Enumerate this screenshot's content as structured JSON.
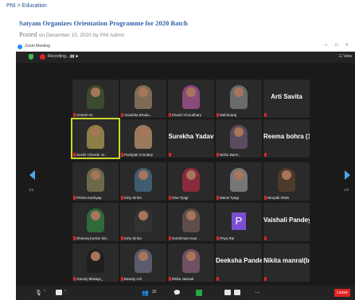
{
  "breadcrumb": "PNI > Education",
  "article": {
    "title": "Satyam Organizes Orientation Programme for 2020 Batch",
    "posted_label": "Posted",
    "posted_on": "on December 15, 2020 by",
    "author": "PNI Admin"
  },
  "zoom": {
    "window_title": "Zoom Meeting",
    "recording_label": "Recording...",
    "recording_controls": "▮▮  ■",
    "view_label": "☷ View",
    "window_controls": [
      "–",
      "□",
      "×"
    ],
    "page_left": "1/2",
    "page_right": "1/2",
    "participant_count": "32",
    "leave_label": "Leave"
  },
  "tiles": [
    {
      "label": "Umesh Nr..",
      "type": "video",
      "color": "#3c4a2e"
    },
    {
      "label": "Anushka Bhadu..",
      "type": "video",
      "color": "#7d6b58"
    },
    {
      "label": "Khushi Choudhary",
      "type": "video",
      "color": "#8a4a7a"
    },
    {
      "label": "Mahimaraj",
      "type": "video",
      "color": "#6a6a6a"
    },
    {
      "label": "",
      "type": "name",
      "name": "Arti Savita"
    },
    {
      "label": "Sushil Chande Jo..",
      "type": "video",
      "color": "#8c7f46",
      "active": true
    },
    {
      "label": "Pushpak S Dubey",
      "type": "video",
      "color": "#9a7a5c"
    },
    {
      "label": "",
      "type": "name",
      "name": "Surekha Yadav"
    },
    {
      "label": "Nishu Barm..",
      "type": "video",
      "color": "#5a4b5e"
    },
    {
      "label": "",
      "type": "name",
      "name": "Reema bohra (1..."
    },
    {
      "label": "Prisha Kashyap",
      "type": "video",
      "color": "#6a6a4a"
    },
    {
      "label": "Kirty Sinha",
      "type": "video",
      "color": "#3f5d6e"
    },
    {
      "label": "Isha Tyagi",
      "type": "video",
      "color": "#8a2b3c"
    },
    {
      "label": "Mansi Tyagi",
      "type": "video",
      "color": "#767676"
    },
    {
      "label": "Nirupali Shah",
      "type": "video",
      "color": "#4e3a2a"
    },
    {
      "label": "Dheeraj Kumar Sin..",
      "type": "video",
      "color": "#2f6a3a"
    },
    {
      "label": "Kirty Sinha",
      "type": "video",
      "color": "#333333"
    },
    {
      "label": "Gurshman Kaur ..",
      "type": "video",
      "color": "#5c4d4a"
    },
    {
      "label": "Priya Rai",
      "type": "avatar",
      "letter": "P"
    },
    {
      "label": "",
      "type": "name",
      "name": "Vaishali Pandey"
    },
    {
      "label": "Garvity Bhateja_",
      "type": "video",
      "color": "#1f1f1f"
    },
    {
      "label": "Beauty Giri",
      "type": "video",
      "color": "#5b5b6e"
    },
    {
      "label": "Ritika Jaiswal",
      "type": "video",
      "color": "#6e5060"
    },
    {
      "label": "",
      "type": "name",
      "name": "Deeksha Pandey"
    },
    {
      "label": "",
      "type": "name",
      "name": "Nikita manral(b..."
    }
  ]
}
